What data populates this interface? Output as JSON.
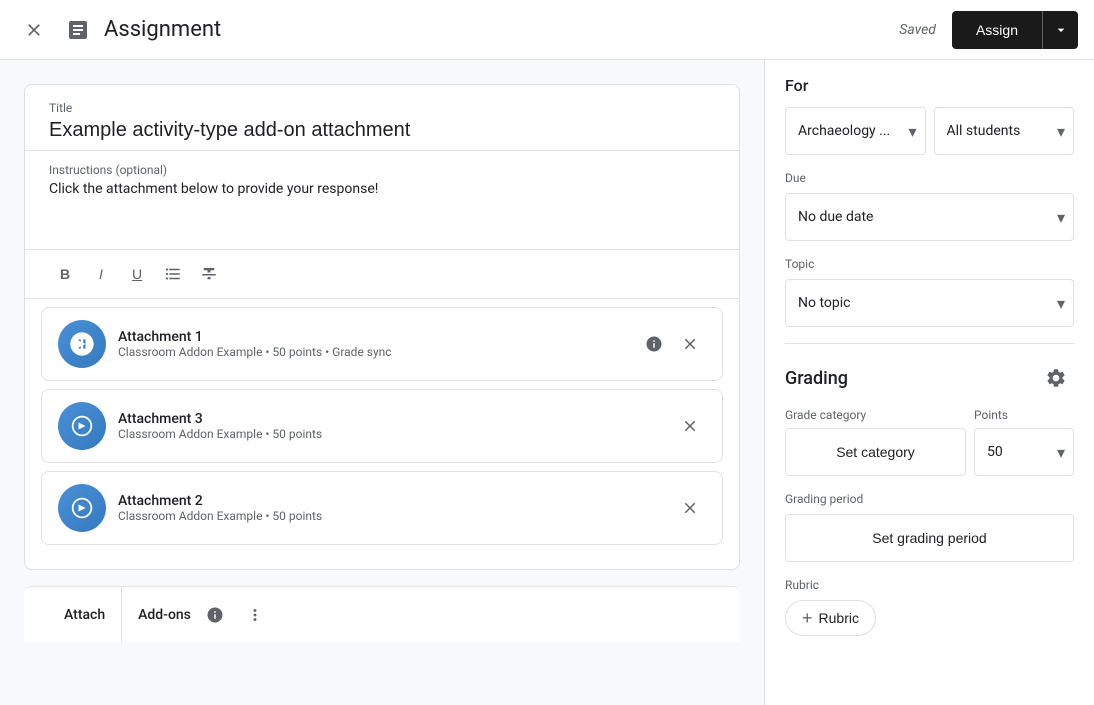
{
  "header": {
    "title": "Assignment",
    "saved_text": "Saved",
    "assign_btn": "Assign",
    "close_icon": "×",
    "doc_icon": "📄"
  },
  "left": {
    "title_label": "Title",
    "title_value": "Example activity-type add-on attachment",
    "instructions_label": "Instructions (optional)",
    "instructions_value": "Click the attachment below to provide your response!",
    "toolbar": {
      "bold": "B",
      "italic": "I",
      "underline": "U",
      "list": "≡",
      "strikethrough": "S"
    },
    "attachments": [
      {
        "name": "Attachment 1",
        "meta": "Classroom Addon Example • 50 points • Grade sync"
      },
      {
        "name": "Attachment 3",
        "meta": "Classroom Addon Example • 50 points"
      },
      {
        "name": "Attachment 2",
        "meta": "Classroom Addon Example • 50 points"
      }
    ],
    "bottom_bar": {
      "attach_label": "Attach",
      "addons_label": "Add-ons"
    }
  },
  "right": {
    "for_label": "For",
    "class_dropdown": "Archaeology ...",
    "students_dropdown": "All students",
    "due_label": "Due",
    "due_dropdown": "No due date",
    "topic_label": "Topic",
    "topic_dropdown": "No topic",
    "grading_title": "Grading",
    "grade_category_label": "Grade category",
    "points_label": "Points",
    "set_category_btn": "Set category",
    "points_value": "50",
    "grading_period_label": "Grading period",
    "set_grading_period_btn": "Set grading period",
    "rubric_label": "Rubric",
    "add_rubric_btn": "Rubric"
  }
}
